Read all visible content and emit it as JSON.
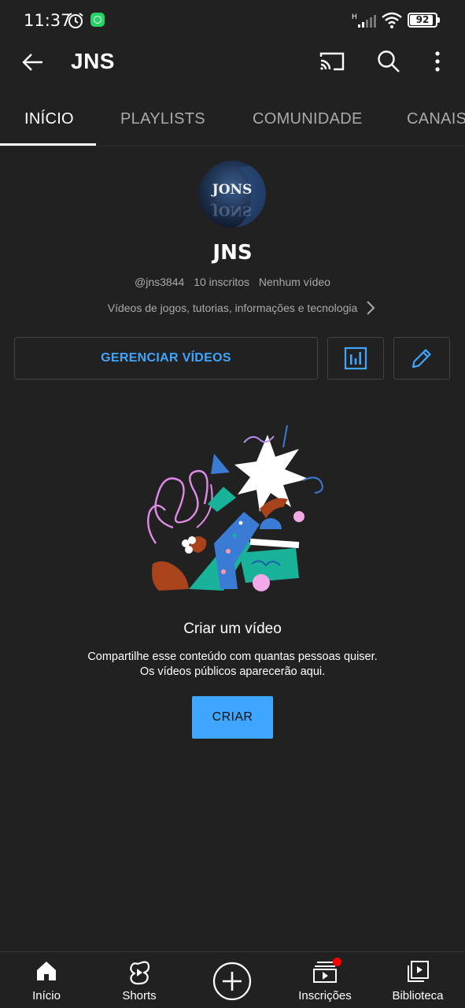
{
  "status_bar": {
    "time": "11:37",
    "network": "H",
    "battery": "92",
    "battery_level": 0.92,
    "icons": [
      "alarm-icon",
      "whatsapp-icon",
      "signal-icon",
      "wifi-icon",
      "battery-icon"
    ]
  },
  "app_bar": {
    "title": "JNS",
    "icons": [
      "back-arrow-icon",
      "cast-icon",
      "search-icon",
      "more-vert-icon"
    ]
  },
  "tabs": [
    {
      "label": "INÍCIO",
      "active": true
    },
    {
      "label": "PLAYLISTS",
      "active": false
    },
    {
      "label": "COMUNIDADE",
      "active": false
    },
    {
      "label": "CANAIS",
      "active": false
    }
  ],
  "channel": {
    "avatar_text": "JONS",
    "name": "JNS",
    "handle": "@jns3844",
    "subscribers": "10 inscritos",
    "videos": "Nenhum vídeo",
    "description": "Vídeos de jogos, tutorias, informações e tecnologia"
  },
  "actions": {
    "manage_label": "GERENCIAR VÍDEOS",
    "icons": [
      "analytics-icon",
      "edit-pencil-icon"
    ]
  },
  "empty_state": {
    "title": "Criar um vídeo",
    "line1": "Compartilhe esse conteúdo com quantas pessoas quiser.",
    "line2": "Os vídeos públicos aparecerão aqui.",
    "button": "CRIAR"
  },
  "bottom_nav": [
    {
      "label": "Início",
      "icon": "home-icon"
    },
    {
      "label": "Shorts",
      "icon": "shorts-icon"
    },
    {
      "label": "",
      "icon": "create-plus-icon"
    },
    {
      "label": "Inscrições",
      "icon": "subscriptions-icon"
    },
    {
      "label": "Biblioteca",
      "icon": "library-icon"
    }
  ],
  "colors": {
    "background": "#212121",
    "accent_blue": "#3ea6ff",
    "muted_text": "#aaaaaa",
    "notification_red": "#ff0000"
  }
}
